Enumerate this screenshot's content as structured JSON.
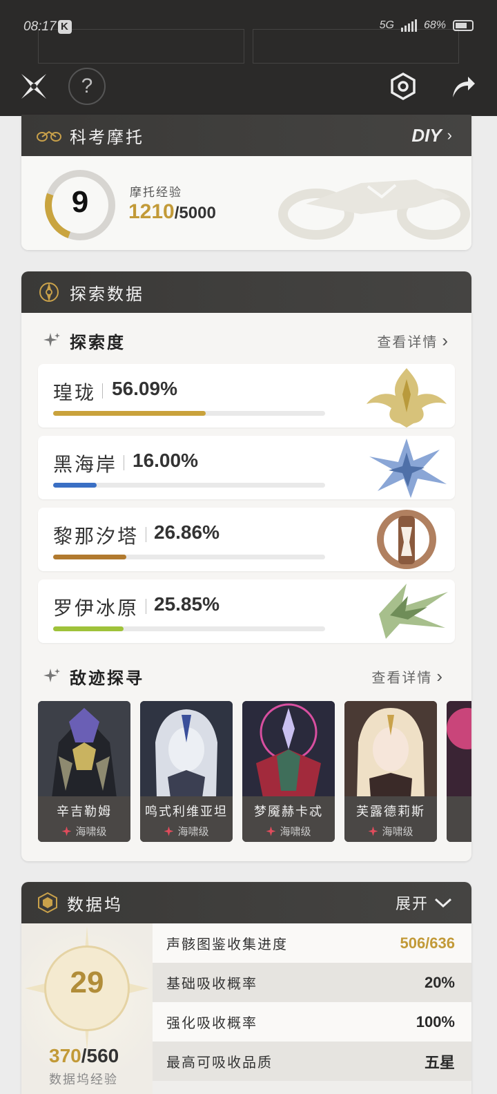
{
  "status": {
    "time": "08:17",
    "network": "5G",
    "battery": "68%"
  },
  "colors": {
    "gold": "#c29a38",
    "header_bg": "#2b2a29"
  },
  "motor": {
    "title": "科考摩托",
    "diy_label": "DIY",
    "level": "9",
    "exp_label": "摩托经验",
    "exp_current": "1210",
    "exp_total": "/5000"
  },
  "explore": {
    "title": "探索数据",
    "section_title": "探索度",
    "more": "查看详情",
    "regions": [
      {
        "name": "瑝珑",
        "percent": "56.09%",
        "progress": 0.5609,
        "color": "#c9a23c"
      },
      {
        "name": "黑海岸",
        "percent": "16.00%",
        "progress": 0.16,
        "color": "#3a6fc4"
      },
      {
        "name": "黎那汐塔",
        "percent": "26.86%",
        "progress": 0.2686,
        "color": "#b17a2e"
      },
      {
        "name": "罗伊冰原",
        "percent": "25.85%",
        "progress": 0.2585,
        "color": "#9fc23a"
      }
    ]
  },
  "enemies": {
    "section_title": "敌迹探寻",
    "more": "查看详情",
    "cards": [
      {
        "name": "辛吉勒姆",
        "level": "海啸级"
      },
      {
        "name": "鸣式利维亚坦",
        "level": "海啸级"
      },
      {
        "name": "梦魇赫卡忒",
        "level": "海啸级"
      },
      {
        "name": "芙露德莉斯",
        "level": "海啸级"
      }
    ]
  },
  "dock": {
    "title": "数据坞",
    "expand": "展开",
    "level": "29",
    "exp_current": "370",
    "exp_total": "/560",
    "exp_label": "数据坞经验",
    "rows": [
      {
        "label": "声骸图鉴收集进度",
        "value": "506/636"
      },
      {
        "label": "基础吸收概率",
        "value": "20%"
      },
      {
        "label": "强化吸收概率",
        "value": "100%"
      },
      {
        "label": "最高可吸收品质",
        "value": "五星"
      }
    ]
  }
}
